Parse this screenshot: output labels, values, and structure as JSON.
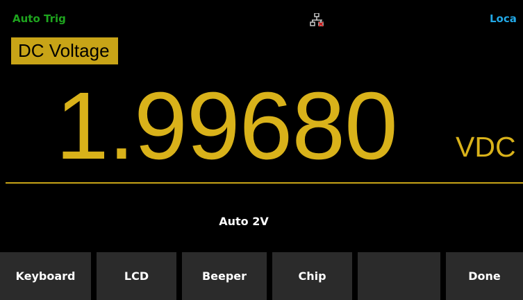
{
  "status": {
    "trigger": "Auto Trig",
    "network_icon": "lan-disconnected-icon",
    "remote": "Loca"
  },
  "measurement": {
    "function": "DC Voltage",
    "reading": "1.99680",
    "unit": "VDC",
    "range": "Auto 2V"
  },
  "softkeys": [
    {
      "label": "Keyboard"
    },
    {
      "label": "LCD"
    },
    {
      "label": "Beeper"
    },
    {
      "label": "Chip"
    },
    {
      "label": ""
    },
    {
      "label": "Done"
    }
  ],
  "colors": {
    "accent": "#c8a417",
    "reading": "#d9b21a",
    "trigger": "#1ea51e",
    "remote": "#22a8e6",
    "softkey_bg": "#2b2b2b",
    "background": "#000000"
  }
}
